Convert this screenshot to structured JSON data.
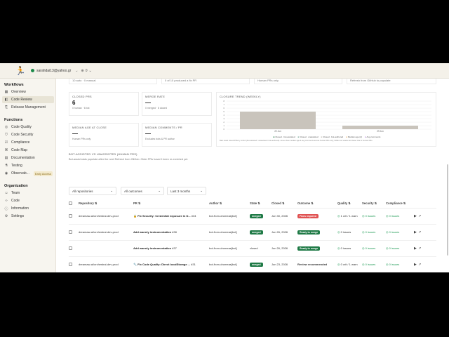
{
  "topbar": {
    "user": "sarahdai13@yahoo.gr",
    "org": "0"
  },
  "sidebar": {
    "workflows_title": "Workflows",
    "workflows": [
      {
        "label": "Overview",
        "icon": "grid-icon"
      },
      {
        "label": "Code Review",
        "icon": "review-icon",
        "active": true
      },
      {
        "label": "Release Management",
        "icon": "release-icon"
      }
    ],
    "functions_title": "Functions",
    "functions": [
      {
        "label": "Code Quality",
        "icon": "quality-icon"
      },
      {
        "label": "Code Security",
        "icon": "security-icon"
      },
      {
        "label": "Compliance",
        "icon": "compliance-icon"
      },
      {
        "label": "Code Map",
        "icon": "map-icon"
      },
      {
        "label": "Documentation",
        "icon": "docs-icon"
      },
      {
        "label": "Testing",
        "icon": "testing-icon"
      },
      {
        "label": "Observab...",
        "icon": "observability-icon",
        "badge": "Early Access"
      }
    ],
    "organization_title": "Organization",
    "organization": [
      {
        "label": "Team",
        "icon": "team-icon"
      },
      {
        "label": "Code",
        "icon": "code-icon"
      },
      {
        "label": "Information",
        "icon": "info-icon"
      },
      {
        "label": "Settings",
        "icon": "settings-icon"
      }
    ]
  },
  "top_strip": {
    "a": "10 auto · 0 manual",
    "b": "0 of 10 produced a fix PR",
    "c": "Human PRs only",
    "d": "Refresh from GitHub to populate"
  },
  "cards": {
    "closed_prs": {
      "label": "CLOSED PRS",
      "value": "6",
      "sub": "0 human · 6 bot"
    },
    "merge_rate": {
      "label": "MERGE RATE",
      "value": "—",
      "sub": "0 merged · 6 closed"
    },
    "median_age": {
      "label": "MEDIAN AGE AT CLOSE",
      "value": "—",
      "sub": "Human PRs only"
    },
    "median_comments": {
      "label": "MEDIAN COMMENTS / PR",
      "value": "—",
      "sub": "Excludes bots & PR author"
    }
  },
  "closure_trend": {
    "label": "CLOSURE TREND (WEEKLY)",
    "legend": [
      "Closed · bot-assisted",
      "Closed · unassisted",
      "Closed · bot-authored",
      "Median age (d)",
      "Avg comments"
    ],
    "footnote": "Bars stack closed PRs by cohort (bot-assisted / unassisted / bot-authored). Lines show median age & avg comments across human PRs only; hidden on weeks with fewer than 2 human PRs."
  },
  "chart_data": {
    "type": "bar",
    "title": "CLOSURE TREND (WEEKLY)",
    "categories": [
      "22 Jun",
      "29 Jun"
    ],
    "series": [
      {
        "name": "Closed · bot-authored",
        "values": [
          5,
          1
        ]
      }
    ],
    "ylim": [
      0,
      8
    ],
    "yticks": [
      0,
      1,
      2,
      3,
      4,
      5,
      6,
      7,
      8
    ]
  },
  "bot_assisted": {
    "title": "BOT-ASSISTED VS UNASSISTED (HUMAN PRS)",
    "note": "Bot-assist stats populate after the next Refresh from GitHub. Older PRs haven't been re-enriched yet."
  },
  "filters": [
    "All repositories",
    "All outcomes",
    "Last 3 months"
  ],
  "table": {
    "headers": [
      "Repository",
      "PR",
      "Author",
      "State",
      "Closed",
      "Outcome",
      "Quality",
      "Security",
      "Compliance"
    ],
    "rows": [
      {
        "repo": "dreamaw-ai/orchestrai-dev-prod",
        "pr": "🔒 Fix Security: Credential exposure in D...",
        "num": "#34",
        "author": "bot-from-dromeas[bot]",
        "state": "merged",
        "closed": "Jun 30, 2026",
        "outcome": "Fixes required",
        "oc": "fixes",
        "quality": "1 crit / 1 warn",
        "security": "0 issues",
        "compliance": "0 issues"
      },
      {
        "repo": "dreamaw-ai/orchestrai-dev-prod",
        "pr": "Add warmly instrumentation",
        "num": "#38",
        "author": "bot-from-dromeas[bot]",
        "state": "merged",
        "closed": "Jun 26, 2026",
        "outcome": "Ready to merge",
        "oc": "ready",
        "quality": "0 issues",
        "security": "0 issues",
        "compliance": "0 issues"
      },
      {
        "repo": "",
        "pr": "Add warmly instrumentation",
        "num": "#37",
        "author": "bot-from-dromeas[bot]",
        "state": "closed",
        "closed": "Jun 26, 2026",
        "outcome": "Ready to merge",
        "oc": "ready",
        "quality": "0 issues",
        "security": "0 issues",
        "compliance": "0 issues"
      },
      {
        "repo": "dreamaw-ai/orchestrai-dev-prod",
        "pr": "🔧 Fix Code Quality: Direct localStorage ...",
        "num": "#31",
        "author": "bot-from-dromeas[bot]",
        "state": "merged",
        "closed": "Jun 23, 2026",
        "outcome": "Review recommended",
        "oc": "text",
        "quality": "0 crit / 1 warn",
        "security": "0 issues",
        "compliance": "0 issues"
      },
      {
        "repo": "dreamaw-ai/orchestrai-dev-prod",
        "pr": "🔧 Fix Code Quality: Diverse error handli...",
        "num": "#25",
        "author": "bot-from-dromeas[bot]",
        "state": "merged",
        "closed": "Jun 23, 2026",
        "outcome": "Ready to merge",
        "oc": "ready",
        "quality": "0 issues",
        "security": "0 issues",
        "compliance": "0 crit / 1 warn"
      }
    ]
  }
}
